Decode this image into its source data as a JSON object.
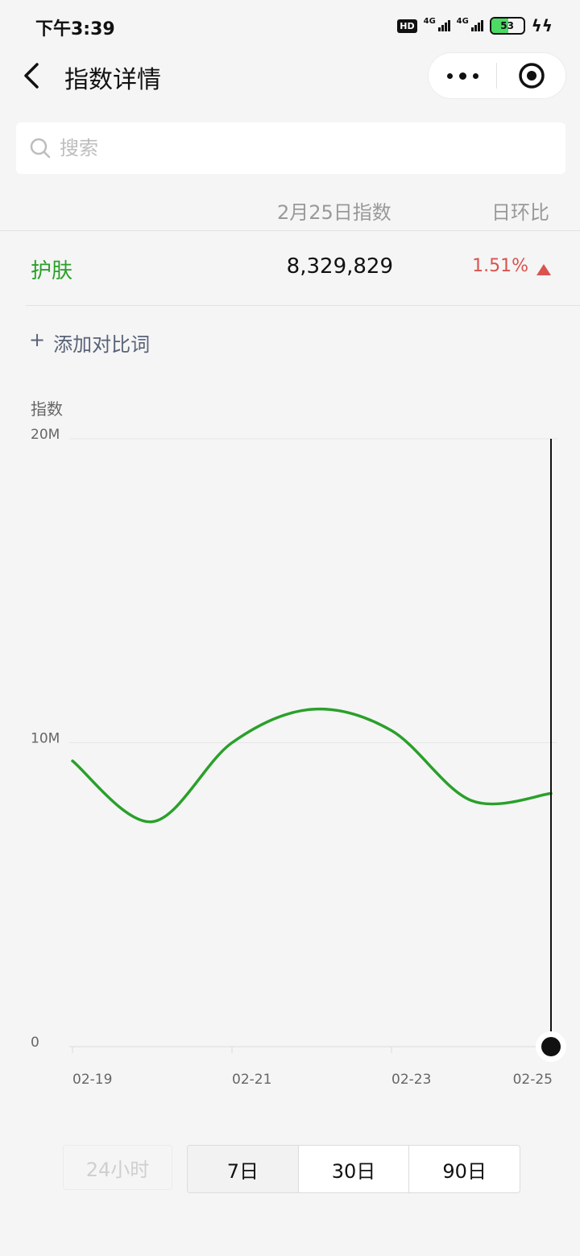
{
  "status_bar": {
    "time": "下午3:39",
    "hd": "HD",
    "net1": "4G",
    "net2": "4G",
    "battery": "53"
  },
  "nav": {
    "title": "指数详情"
  },
  "search": {
    "placeholder": "搜索"
  },
  "table": {
    "date_header": "2月25日指数",
    "ratio_header": "日环比",
    "row": {
      "keyword": "护肤",
      "value": "8,329,829",
      "change": "1.51%",
      "direction": "up"
    }
  },
  "add_compare": {
    "plus": "+",
    "label": "添加对比词"
  },
  "chart_data": {
    "type": "line",
    "ylabel": "指数",
    "y_ticks": [
      "20M",
      "10M",
      "0"
    ],
    "ylim": [
      0,
      20000000
    ],
    "x_tick_labels": [
      "02-19",
      "02-21",
      "02-23",
      "02-25"
    ],
    "x": [
      "02-19",
      "02-20",
      "02-21",
      "02-22",
      "02-23",
      "02-24",
      "02-25"
    ],
    "series": [
      {
        "color": "#2aa02a",
        "values": [
          9400000,
          7400000,
          10000000,
          11100000,
          10400000,
          8100000,
          8329829
        ]
      }
    ],
    "cursor_at": "02-25"
  },
  "range": {
    "h24": "24小时",
    "d7": "7日",
    "d30": "30日",
    "d90": "90日",
    "selected": "7日"
  }
}
